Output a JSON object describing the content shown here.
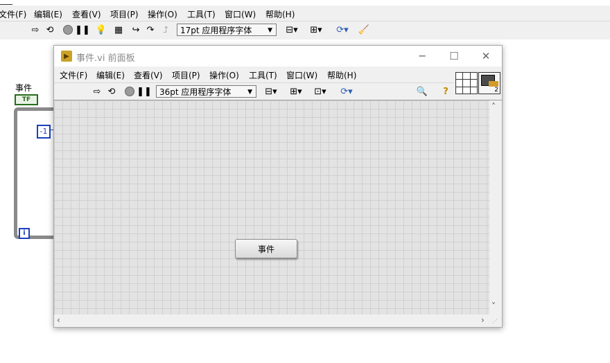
{
  "block_diagram": {
    "menu": [
      "文件(F)",
      "编辑(E)",
      "查看(V)",
      "项目(P)",
      "操作(O)",
      "工具(T)",
      "窗口(W)",
      "帮助(H)"
    ],
    "font_select": "17pt 应用程序字体",
    "event_terminal_label": "事件",
    "bool_const": "TF",
    "loop_const": "-1",
    "iteration_terminal": "i"
  },
  "front_panel": {
    "title": "事件.vi 前面板",
    "menu": [
      "文件(F)",
      "编辑(E)",
      "查看(V)",
      "项目(P)",
      "操作(O)",
      "工具(T)",
      "窗口(W)",
      "帮助(H)"
    ],
    "font_select": "36pt 应用程序字体",
    "connector_count": "2",
    "button_label": "事件"
  }
}
